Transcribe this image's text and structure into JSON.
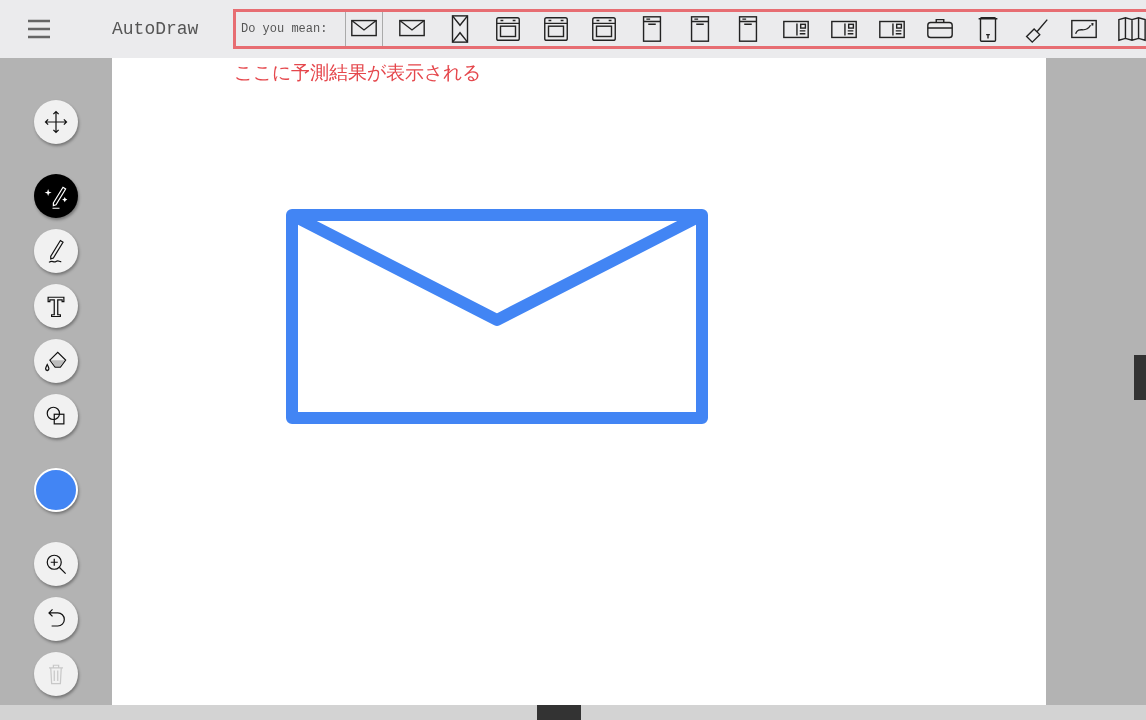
{
  "app": {
    "title": "AutoDraw"
  },
  "suggestions": {
    "label": "Do you mean:",
    "items": [
      {
        "kind": "envelope",
        "selected": true
      },
      {
        "kind": "envelope",
        "selected": false
      },
      {
        "kind": "tall-envelope",
        "selected": false
      },
      {
        "kind": "oven",
        "selected": false
      },
      {
        "kind": "oven",
        "selected": false
      },
      {
        "kind": "oven",
        "selected": false
      },
      {
        "kind": "dishwasher",
        "selected": false
      },
      {
        "kind": "dishwasher",
        "selected": false
      },
      {
        "kind": "dishwasher",
        "selected": false
      },
      {
        "kind": "postcard",
        "selected": false
      },
      {
        "kind": "postcard",
        "selected": false
      },
      {
        "kind": "postcard",
        "selected": false
      },
      {
        "kind": "cooler",
        "selected": false
      },
      {
        "kind": "container",
        "selected": false
      },
      {
        "kind": "brush",
        "selected": false
      },
      {
        "kind": "map",
        "selected": false
      },
      {
        "kind": "folded-map",
        "selected": false
      }
    ]
  },
  "annotation": "ここに予測結果が表示される",
  "tool_groups": [
    [
      {
        "kind": "move",
        "selected": false,
        "disabled": false
      }
    ],
    [
      {
        "kind": "autodraw",
        "selected": true,
        "disabled": false
      },
      {
        "kind": "draw",
        "selected": false,
        "disabled": false
      },
      {
        "kind": "type",
        "selected": false,
        "disabled": false
      },
      {
        "kind": "fill",
        "selected": false,
        "disabled": false
      },
      {
        "kind": "shape",
        "selected": false,
        "disabled": false
      }
    ],
    [
      {
        "kind": "color",
        "color": "#4285f4"
      }
    ],
    [
      {
        "kind": "zoom",
        "selected": false,
        "disabled": false
      },
      {
        "kind": "undo",
        "selected": false,
        "disabled": false
      },
      {
        "kind": "delete",
        "selected": false,
        "disabled": true
      }
    ]
  ],
  "drawing": {
    "kind": "envelope",
    "color": "#4285f4"
  }
}
